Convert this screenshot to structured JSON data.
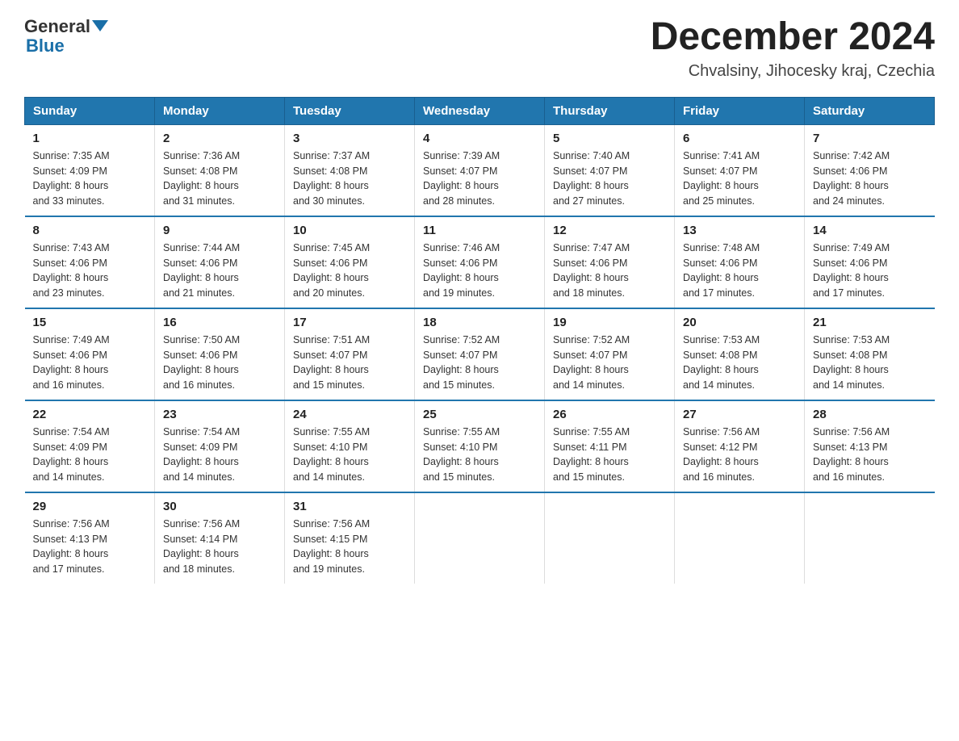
{
  "header": {
    "logo_general": "General",
    "logo_blue": "Blue",
    "title": "December 2024",
    "subtitle": "Chvalsiny, Jihocesky kraj, Czechia"
  },
  "days_of_week": [
    "Sunday",
    "Monday",
    "Tuesday",
    "Wednesday",
    "Thursday",
    "Friday",
    "Saturday"
  ],
  "weeks": [
    [
      {
        "num": "1",
        "sunrise": "7:35 AM",
        "sunset": "4:09 PM",
        "daylight": "8 hours and 33 minutes."
      },
      {
        "num": "2",
        "sunrise": "7:36 AM",
        "sunset": "4:08 PM",
        "daylight": "8 hours and 31 minutes."
      },
      {
        "num": "3",
        "sunrise": "7:37 AM",
        "sunset": "4:08 PM",
        "daylight": "8 hours and 30 minutes."
      },
      {
        "num": "4",
        "sunrise": "7:39 AM",
        "sunset": "4:07 PM",
        "daylight": "8 hours and 28 minutes."
      },
      {
        "num": "5",
        "sunrise": "7:40 AM",
        "sunset": "4:07 PM",
        "daylight": "8 hours and 27 minutes."
      },
      {
        "num": "6",
        "sunrise": "7:41 AM",
        "sunset": "4:07 PM",
        "daylight": "8 hours and 25 minutes."
      },
      {
        "num": "7",
        "sunrise": "7:42 AM",
        "sunset": "4:06 PM",
        "daylight": "8 hours and 24 minutes."
      }
    ],
    [
      {
        "num": "8",
        "sunrise": "7:43 AM",
        "sunset": "4:06 PM",
        "daylight": "8 hours and 23 minutes."
      },
      {
        "num": "9",
        "sunrise": "7:44 AM",
        "sunset": "4:06 PM",
        "daylight": "8 hours and 21 minutes."
      },
      {
        "num": "10",
        "sunrise": "7:45 AM",
        "sunset": "4:06 PM",
        "daylight": "8 hours and 20 minutes."
      },
      {
        "num": "11",
        "sunrise": "7:46 AM",
        "sunset": "4:06 PM",
        "daylight": "8 hours and 19 minutes."
      },
      {
        "num": "12",
        "sunrise": "7:47 AM",
        "sunset": "4:06 PM",
        "daylight": "8 hours and 18 minutes."
      },
      {
        "num": "13",
        "sunrise": "7:48 AM",
        "sunset": "4:06 PM",
        "daylight": "8 hours and 17 minutes."
      },
      {
        "num": "14",
        "sunrise": "7:49 AM",
        "sunset": "4:06 PM",
        "daylight": "8 hours and 17 minutes."
      }
    ],
    [
      {
        "num": "15",
        "sunrise": "7:49 AM",
        "sunset": "4:06 PM",
        "daylight": "8 hours and 16 minutes."
      },
      {
        "num": "16",
        "sunrise": "7:50 AM",
        "sunset": "4:06 PM",
        "daylight": "8 hours and 16 minutes."
      },
      {
        "num": "17",
        "sunrise": "7:51 AM",
        "sunset": "4:07 PM",
        "daylight": "8 hours and 15 minutes."
      },
      {
        "num": "18",
        "sunrise": "7:52 AM",
        "sunset": "4:07 PM",
        "daylight": "8 hours and 15 minutes."
      },
      {
        "num": "19",
        "sunrise": "7:52 AM",
        "sunset": "4:07 PM",
        "daylight": "8 hours and 14 minutes."
      },
      {
        "num": "20",
        "sunrise": "7:53 AM",
        "sunset": "4:08 PM",
        "daylight": "8 hours and 14 minutes."
      },
      {
        "num": "21",
        "sunrise": "7:53 AM",
        "sunset": "4:08 PM",
        "daylight": "8 hours and 14 minutes."
      }
    ],
    [
      {
        "num": "22",
        "sunrise": "7:54 AM",
        "sunset": "4:09 PM",
        "daylight": "8 hours and 14 minutes."
      },
      {
        "num": "23",
        "sunrise": "7:54 AM",
        "sunset": "4:09 PM",
        "daylight": "8 hours and 14 minutes."
      },
      {
        "num": "24",
        "sunrise": "7:55 AM",
        "sunset": "4:10 PM",
        "daylight": "8 hours and 14 minutes."
      },
      {
        "num": "25",
        "sunrise": "7:55 AM",
        "sunset": "4:10 PM",
        "daylight": "8 hours and 15 minutes."
      },
      {
        "num": "26",
        "sunrise": "7:55 AM",
        "sunset": "4:11 PM",
        "daylight": "8 hours and 15 minutes."
      },
      {
        "num": "27",
        "sunrise": "7:56 AM",
        "sunset": "4:12 PM",
        "daylight": "8 hours and 16 minutes."
      },
      {
        "num": "28",
        "sunrise": "7:56 AM",
        "sunset": "4:13 PM",
        "daylight": "8 hours and 16 minutes."
      }
    ],
    [
      {
        "num": "29",
        "sunrise": "7:56 AM",
        "sunset": "4:13 PM",
        "daylight": "8 hours and 17 minutes."
      },
      {
        "num": "30",
        "sunrise": "7:56 AM",
        "sunset": "4:14 PM",
        "daylight": "8 hours and 18 minutes."
      },
      {
        "num": "31",
        "sunrise": "7:56 AM",
        "sunset": "4:15 PM",
        "daylight": "8 hours and 19 minutes."
      },
      null,
      null,
      null,
      null
    ]
  ],
  "labels": {
    "sunrise": "Sunrise:",
    "sunset": "Sunset:",
    "daylight": "Daylight:"
  }
}
